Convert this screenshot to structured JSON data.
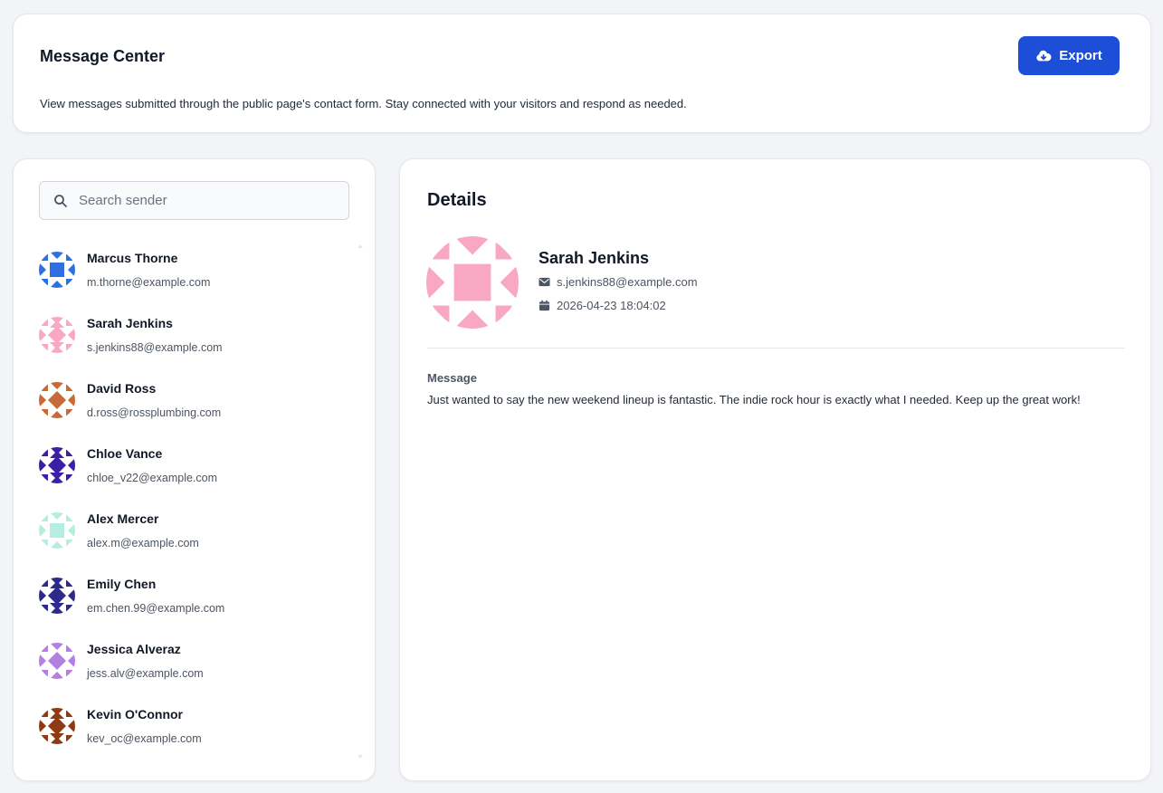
{
  "header": {
    "title": "Message Center",
    "description": "View messages submitted through the public page's contact form. Stay connected with your visitors and respond as needed.",
    "export_label": "Export"
  },
  "search": {
    "placeholder": "Search sender"
  },
  "senders": [
    {
      "name": "Marcus Thorne",
      "email": "m.thorne@example.com",
      "color": "#2f6fdf"
    },
    {
      "name": "Sarah Jenkins",
      "email": "s.jenkins88@example.com",
      "color": "#f9a8c4"
    },
    {
      "name": "David Ross",
      "email": "d.ross@rossplumbing.com",
      "color": "#c8693a"
    },
    {
      "name": "Chloe Vance",
      "email": "chloe_v22@example.com",
      "color": "#3b1fa5"
    },
    {
      "name": "Alex Mercer",
      "email": "alex.m@example.com",
      "color": "#b5ede0"
    },
    {
      "name": "Emily Chen",
      "email": "em.chen.99@example.com",
      "color": "#2d2a8c"
    },
    {
      "name": "Jessica Alveraz",
      "email": "jess.alv@example.com",
      "color": "#b37fe0"
    },
    {
      "name": "Kevin O'Connor",
      "email": "kev_oc@example.com",
      "color": "#8e3a14"
    }
  ],
  "details": {
    "title": "Details",
    "name": "Sarah Jenkins",
    "email": "s.jenkins88@example.com",
    "date": "2026-04-23 18:04:02",
    "avatar_color": "#f9a8c4",
    "message_label": "Message",
    "message": "Just wanted to say the new weekend lineup is fantastic. The indie rock hour is exactly what I needed. Keep up the great work!"
  },
  "colors": {
    "accent": "#1d4ed8",
    "background": "#f3f4f7"
  }
}
